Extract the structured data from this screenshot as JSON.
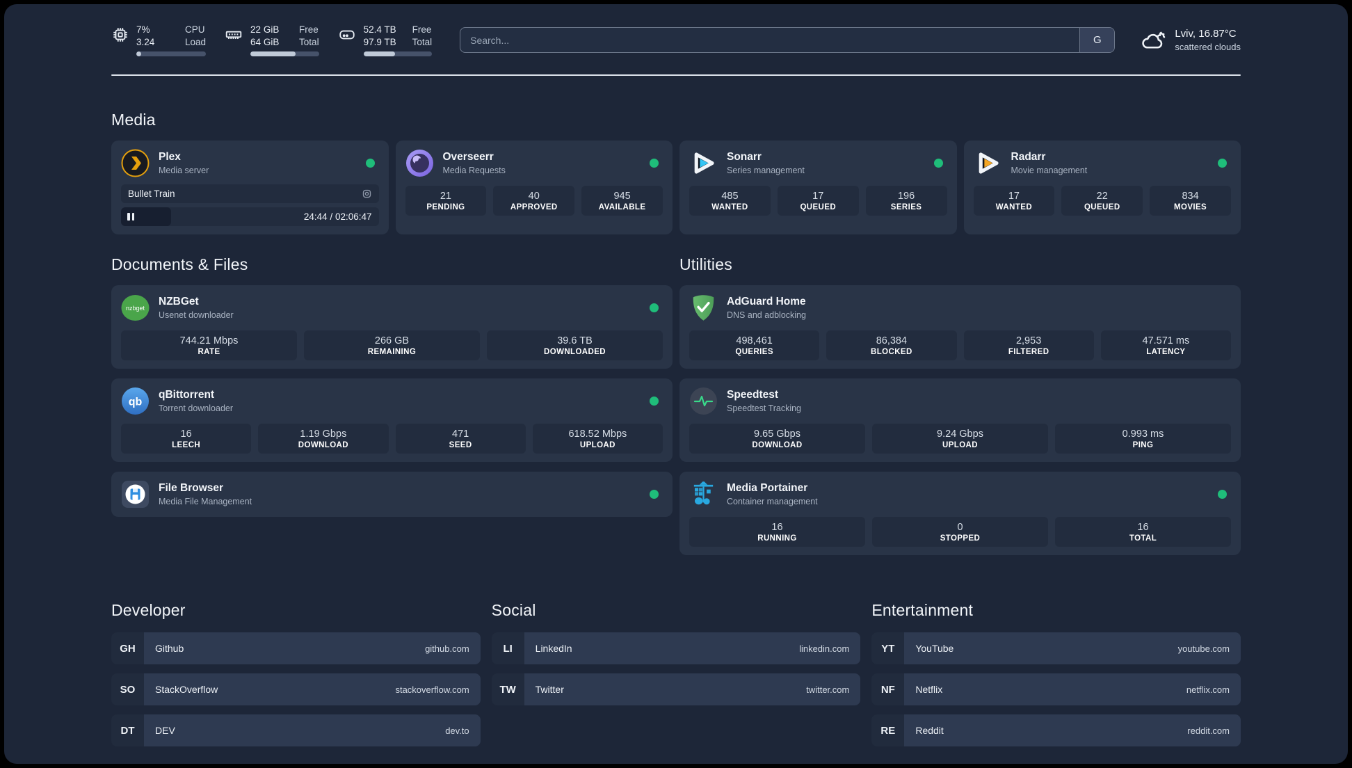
{
  "topbar": {
    "cpu": {
      "values": [
        "7%",
        "3.24"
      ],
      "labels": [
        "CPU",
        "Load"
      ],
      "progress_pct": 7
    },
    "memory": {
      "values": [
        "22 GiB",
        "64 GiB"
      ],
      "labels": [
        "Free",
        "Total"
      ],
      "progress_pct": 66
    },
    "disk": {
      "values": [
        "52.4 TB",
        "97.9 TB"
      ],
      "labels": [
        "Free",
        "Total"
      ],
      "progress_pct": 46
    },
    "search": {
      "placeholder": "Search...",
      "engine_button": "G"
    },
    "weather": {
      "location_temp": "Lviv, 16.87°C",
      "condition": "scattered clouds"
    }
  },
  "sections": {
    "media": {
      "title": "Media",
      "apps": [
        {
          "name": "Plex",
          "desc": "Media server",
          "online": true,
          "now_playing": {
            "title": "Bullet Train",
            "time": "24:44 / 02:06:47",
            "progress_pct": 19.5
          }
        },
        {
          "name": "Overseerr",
          "desc": "Media Requests",
          "online": true,
          "stats": [
            {
              "value": "21",
              "label": "PENDING"
            },
            {
              "value": "40",
              "label": "APPROVED"
            },
            {
              "value": "945",
              "label": "AVAILABLE"
            }
          ]
        },
        {
          "name": "Sonarr",
          "desc": "Series management",
          "online": true,
          "stats": [
            {
              "value": "485",
              "label": "WANTED"
            },
            {
              "value": "17",
              "label": "QUEUED"
            },
            {
              "value": "196",
              "label": "SERIES"
            }
          ]
        },
        {
          "name": "Radarr",
          "desc": "Movie management",
          "online": true,
          "stats": [
            {
              "value": "17",
              "label": "WANTED"
            },
            {
              "value": "22",
              "label": "QUEUED"
            },
            {
              "value": "834",
              "label": "MOVIES"
            }
          ]
        }
      ]
    },
    "documents": {
      "title": "Documents & Files",
      "apps": [
        {
          "name": "NZBGet",
          "desc": "Usenet downloader",
          "online": true,
          "stats": [
            {
              "value": "744.21 Mbps",
              "label": "RATE"
            },
            {
              "value": "266 GB",
              "label": "REMAINING"
            },
            {
              "value": "39.6 TB",
              "label": "DOWNLOADED"
            }
          ]
        },
        {
          "name": "qBittorrent",
          "desc": "Torrent downloader",
          "online": true,
          "stats": [
            {
              "value": "16",
              "label": "LEECH"
            },
            {
              "value": "1.19 Gbps",
              "label": "DOWNLOAD"
            },
            {
              "value": "471",
              "label": "SEED"
            },
            {
              "value": "618.52 Mbps",
              "label": "UPLOAD"
            }
          ]
        },
        {
          "name": "File Browser",
          "desc": "Media File Management",
          "online": true,
          "stats": []
        }
      ]
    },
    "utilities": {
      "title": "Utilities",
      "apps": [
        {
          "name": "AdGuard Home",
          "desc": "DNS and adblocking",
          "online": false,
          "stats": [
            {
              "value": "498,461",
              "label": "QUERIES"
            },
            {
              "value": "86,384",
              "label": "BLOCKED"
            },
            {
              "value": "2,953",
              "label": "FILTERED"
            },
            {
              "value": "47.571 ms",
              "label": "LATENCY"
            }
          ]
        },
        {
          "name": "Speedtest",
          "desc": "Speedtest Tracking",
          "online": false,
          "stats": [
            {
              "value": "9.65 Gbps",
              "label": "DOWNLOAD"
            },
            {
              "value": "9.24 Gbps",
              "label": "UPLOAD"
            },
            {
              "value": "0.993 ms",
              "label": "PING"
            }
          ]
        },
        {
          "name": "Media Portainer",
          "desc": "Container management",
          "online": true,
          "stats": [
            {
              "value": "16",
              "label": "RUNNING"
            },
            {
              "value": "0",
              "label": "STOPPED"
            },
            {
              "value": "16",
              "label": "TOTAL"
            }
          ]
        }
      ]
    },
    "links": [
      {
        "title": "Developer",
        "items": [
          {
            "abbr": "GH",
            "name": "Github",
            "url": "github.com"
          },
          {
            "abbr": "SO",
            "name": "StackOverflow",
            "url": "stackoverflow.com"
          },
          {
            "abbr": "DT",
            "name": "DEV",
            "url": "dev.to"
          }
        ]
      },
      {
        "title": "Social",
        "items": [
          {
            "abbr": "LI",
            "name": "LinkedIn",
            "url": "linkedin.com"
          },
          {
            "abbr": "TW",
            "name": "Twitter",
            "url": "twitter.com"
          }
        ]
      },
      {
        "title": "Entertainment",
        "items": [
          {
            "abbr": "YT",
            "name": "YouTube",
            "url": "youtube.com"
          },
          {
            "abbr": "NF",
            "name": "Netflix",
            "url": "netflix.com"
          },
          {
            "abbr": "RE",
            "name": "Reddit",
            "url": "reddit.com"
          }
        ]
      }
    ]
  },
  "colors": {
    "status_online": "#1fbd7a",
    "background": "#1d2638",
    "card": "#293447",
    "tile": "#222c3e"
  }
}
